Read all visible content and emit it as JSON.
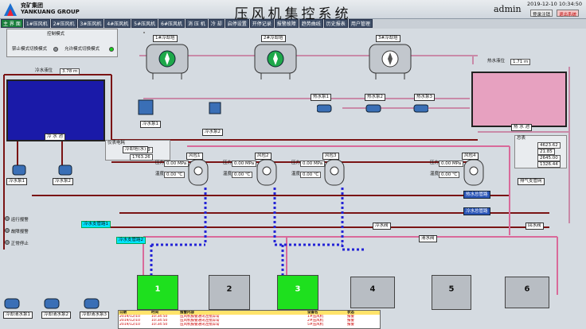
{
  "header": {
    "company_cn": "兖矿集团",
    "company_en": "YANKUANG GROUP",
    "title": "压风机集控系统",
    "user": "admin",
    "datetime": "2019-12-10 10:34:50",
    "logout_label": "登录注销",
    "exit_label": "退出系统"
  },
  "nav": [
    "主 界 面",
    "1#压风机",
    "2#压风机",
    "3#压风机",
    "4#压风机",
    "5#压风机",
    "6#压风机",
    "消 压 机",
    "冷 却",
    "启停设置",
    "开停记录",
    "报警故障",
    "趋势曲线",
    "历史报表",
    "用户管理"
  ],
  "control_panel": {
    "title": "控制模式",
    "modes": [
      "禁止模式切换模式",
      "允许模式切换模式"
    ]
  },
  "tanks": {
    "cold_water": "冷 水 池",
    "hot_water": "热 水 池",
    "cold_level_label": "冷水液位",
    "cold_level_value": "3.78 m",
    "hot_level_label": "热水液位",
    "hot_level_value": "1.71 m"
  },
  "heat_exchangers": [
    "1#冷却塔",
    "2#冷却塔",
    "3#冷却塔"
  ],
  "hot_pumps": [
    "热水泵1",
    "热水泵2",
    "热水泵3"
  ],
  "supply_labels": {
    "supply_pipe": "冷水支管路1",
    "supply_pipe2": "冷水支管路2",
    "return_pipe1": "热水总管路",
    "return_pipe2": "冷水总管路",
    "valve1": "冷水阀",
    "valve2": "清水阀",
    "cooling": "冷却塔(水)",
    "exhaust_fan": "回水阀",
    "temp_label": "温度",
    "pressure_label": "压力",
    "hot_pipe_label": "排气支管网"
  },
  "air_tanks": [
    "风包1",
    "风包2",
    "风包3",
    "风包4"
  ],
  "air_tank_values": [
    {
      "pressure": "0.00 MPa",
      "temp": "0.00 ℃"
    },
    {
      "pressure": "0.00 MPa",
      "temp": "0.00 ℃"
    },
    {
      "pressure": "0.00 MPa",
      "temp": "0.00 ℃"
    },
    {
      "pressure": "0.00 MPa",
      "temp": "0.00 ℃"
    }
  ],
  "meter_left": {
    "title": "仪表电耗",
    "row1": "2541.69",
    "row2": "1763.26"
  },
  "meter_right": {
    "title": "总表",
    "rows": [
      "4623.62",
      "21.85",
      "2645.00",
      "1326.44"
    ]
  },
  "cold_pumps": [
    "冷水泵1",
    "冷水泵2"
  ],
  "bottom_pumps": [
    "冷却清水泵1",
    "冷却清水泵2",
    "冷却清水泵3"
  ],
  "status_legend": [
    "运行报警",
    "故障报警",
    "正常停止"
  ],
  "compressors": [
    {
      "num": "1",
      "state": "run"
    },
    {
      "num": "2",
      "state": "stop"
    },
    {
      "num": "3",
      "state": "run"
    },
    {
      "num": "4",
      "state": "stop"
    },
    {
      "num": "5",
      "state": "stop"
    },
    {
      "num": "6",
      "state": "stop"
    }
  ],
  "alarm_table": {
    "headers": [
      "日期",
      "时间",
      "报警内容",
      "设备名",
      "状态"
    ],
    "rows": [
      [
        "2019/12/10",
        "10:34:50",
        "压风机报警通讯连接异常",
        "1#压风机",
        "报警"
      ],
      [
        "2019/12/10",
        "10:34:50",
        "压风机报警通讯连接异常",
        "2#压风机",
        "报警"
      ],
      [
        "2019/12/10",
        "10:34:50",
        "压风机报警通讯连接异常",
        "5#压风机",
        "报警"
      ]
    ]
  },
  "colors": {
    "cold_pipe": "#7a1414",
    "hot_pipe": "#c98aa8",
    "air_pipe": "#d96a9a",
    "dashed_pipe": "#2323d6",
    "run": "#1ee01e",
    "nav_bg": "#3f4f68"
  }
}
